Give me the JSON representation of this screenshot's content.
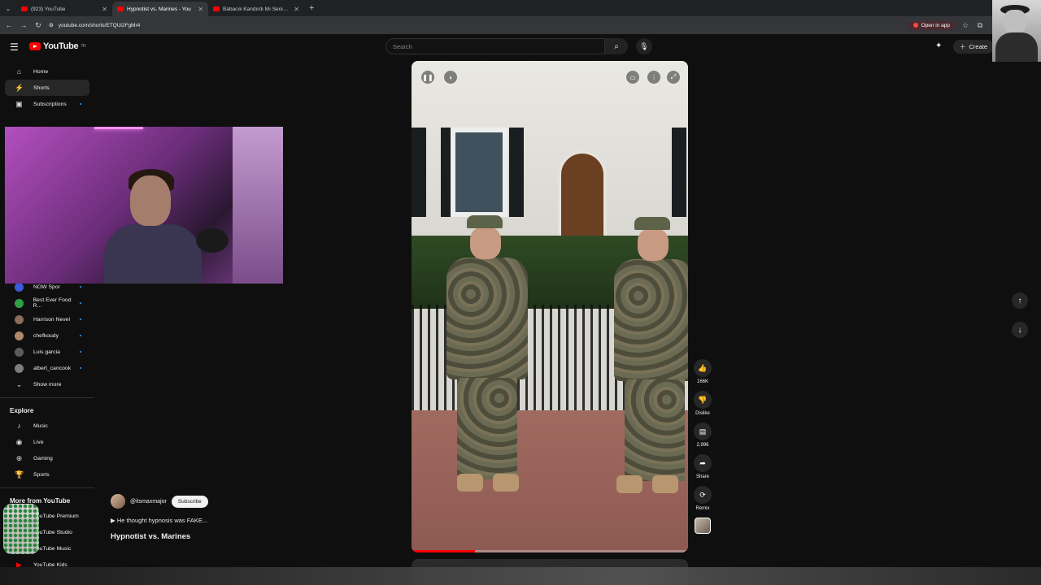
{
  "browser": {
    "tabs": [
      {
        "title": "(923) YouTube",
        "active": false
      },
      {
        "title": "Hypnotist vs. Marines - You",
        "active": true
      },
      {
        "title": "Babacık Kandırdı Mı Seni? - Yo",
        "active": false
      }
    ],
    "url": "youtube.com/shorts/ETQUi2FgMr4",
    "open_in_app": "Open in app"
  },
  "header": {
    "logo_text": "YouTube",
    "logo_sup": "TR",
    "search_placeholder": "Search",
    "create_label": "Create"
  },
  "sidebar": {
    "top": [
      {
        "label": "Home",
        "icon": "home-icon"
      },
      {
        "label": "Shorts",
        "icon": "shorts-icon",
        "active": true
      },
      {
        "label": "Subscriptions",
        "icon": "subscriptions-icon"
      }
    ],
    "subscriptions": [
      {
        "label": "NOW Spor"
      },
      {
        "label": "Best Ever Food R..."
      },
      {
        "label": "Harrison Nevel"
      },
      {
        "label": "chefkoudy"
      },
      {
        "label": "Luis garcia"
      },
      {
        "label": "albert_cancook"
      }
    ],
    "show_more": "Show more",
    "explore_title": "Explore",
    "explore": [
      {
        "label": "Music",
        "icon": "music-icon"
      },
      {
        "label": "Live",
        "icon": "live-icon"
      },
      {
        "label": "Gaming",
        "icon": "gaming-icon"
      },
      {
        "label": "Sports",
        "icon": "sports-icon"
      }
    ],
    "more_title": "More from YouTube",
    "more": [
      {
        "label": "YouTube Premium"
      },
      {
        "label": "YouTube Studio"
      },
      {
        "label": "YouTube Music"
      },
      {
        "label": "YouTube Kids"
      }
    ]
  },
  "short": {
    "channel": "@itsmaxmajor",
    "subscribe": "Subscribe",
    "description": "▶ He thought hypnosis was FAKE...",
    "title": "Hypnotist vs. Marines",
    "progress": 0.23
  },
  "actions": {
    "likes": "166K",
    "dislike": "Dislike",
    "comments": "2,996",
    "share": "Share",
    "remix": "Remix"
  },
  "colors": {
    "accent": "#ff0000",
    "background": "#0f0f0f"
  }
}
